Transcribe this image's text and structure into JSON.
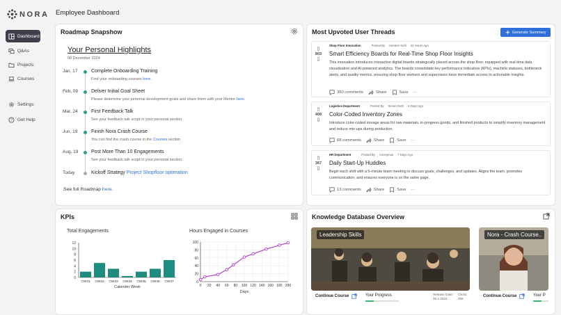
{
  "app": {
    "logo_text": "NORA",
    "page_title": "Employee Dashboard"
  },
  "sidebar": {
    "items": [
      {
        "label": "Dashboard",
        "icon": "dashboard-icon",
        "active": true
      },
      {
        "label": "Q&As",
        "icon": "chat-icon"
      },
      {
        "label": "Projects",
        "icon": "folder-icon"
      },
      {
        "label": "Courses",
        "icon": "laptop-icon"
      }
    ],
    "bottom": [
      {
        "label": "Settings",
        "icon": "gear-icon"
      },
      {
        "label": "Get Help",
        "icon": "help-icon"
      }
    ]
  },
  "roadmap": {
    "title": "Roadmap Snapshow",
    "highlights_title": "Your Personal Highlights",
    "highlights_date": "08 December 2024",
    "items": [
      {
        "date": "Jan, 17",
        "title": "Complete Onboarding Training",
        "sub": "Find your onboarding courses ",
        "link": "here",
        "sub_after": "."
      },
      {
        "date": "Feb, 09",
        "title": "Deliver Initial Goal Sheet",
        "sub": "Please determine your personal development goals and share them with your Mentor ",
        "link": "here",
        "sub_after": "."
      },
      {
        "date": "Mar, 24",
        "title": "First Feedback Talk",
        "sub": "See your feedback talk script in your personal section.",
        "link": "",
        "sub_after": ""
      },
      {
        "date": "Jun, 19",
        "title": "Finish Nora Crash Course",
        "sub": "You can find the crash course in the ",
        "link": "Courses",
        "sub_after": " section"
      },
      {
        "date": "Aug, 19",
        "title": "Post More Than 10 Engagements",
        "sub": "See your feedback talk script in your personal section.",
        "link": "",
        "sub_after": ""
      }
    ],
    "today": {
      "date": "Today",
      "title": "Kickoff Strategy ",
      "link": "Project Shopfloor optimation"
    },
    "footer_text": "See full Roadmap ",
    "footer_link": "here",
    "footer_after": "."
  },
  "threads": {
    "title": "Most Upvoted User Threads",
    "generate_label": "Generate Summary",
    "posted_by_label": "Posted By",
    "items": [
      {
        "votes": "803",
        "category": "Shop Floor Innovation",
        "author": "Karsten Suhl",
        "time": "22 Hours Ago",
        "title": "Smart Efficiency Boards for Real-Time Shop Floor Insights",
        "body": "This innovation introduces interactive digital boards strategically placed across the shop floor, equipped with real-time data visualization and AI-powered analytics. The boards consolidate key performance indicators (KPIs), machine statuses, bottleneck alerts, and quality metrics, ensuring shop floor workers and supervisors have immediate access to actionable insights.",
        "comments": "360 comments",
        "share": "Share",
        "save": "Save",
        "more": "···"
      },
      {
        "votes": "409",
        "category": "Logistics Department",
        "author": "Simon Ruth",
        "time": "3 Days Ago",
        "title": "Color-Coded Inventory Zones",
        "body": "Introduce color-coded storage areas for raw materials, in-progress goods, and finished products to simplify inventory management and reduce mix-ups during production.",
        "comments": "68 comments",
        "share": "Share",
        "save": "Save",
        "more": "···"
      },
      {
        "votes": "367",
        "category": "HR Department",
        "author": "Anonymus",
        "time": "7 Days Ago",
        "title": "Daily Start-Up Huddles",
        "body": "Begin each shift with a 5-minute team meeting to discuss goals, challenges, and updates. Aligns the team, promotes communication, and ensures everyone is on the same page.",
        "comments": "13 comments",
        "share": "Share",
        "save": "Save",
        "more": "···"
      }
    ]
  },
  "kpis": {
    "title": "KPIs"
  },
  "chart_data": [
    {
      "type": "bar",
      "title": "Total Engagements",
      "xlabel": "Calender Week",
      "ylabel": "",
      "categories": [
        "CW31",
        "CW32",
        "CW33",
        "CW34",
        "CW35",
        "CW36",
        "CW37"
      ],
      "values": [
        2,
        5,
        3,
        0.5,
        2,
        3,
        6
      ],
      "ylim": [
        0,
        12
      ],
      "yticks": [
        "0",
        "2",
        "4",
        "6",
        "8",
        "10",
        "12"
      ],
      "color": "#1f8c80"
    },
    {
      "type": "line",
      "title": "Hours Engaged in Courses",
      "xlabel": "Days",
      "ylabel": "",
      "x": [
        0,
        10,
        40,
        60,
        75,
        100,
        120,
        150,
        180,
        200
      ],
      "y": [
        5,
        12,
        18,
        30,
        42,
        62,
        70,
        82,
        92,
        98
      ],
      "xlim": [
        0,
        200
      ],
      "ylim": [
        0,
        100
      ],
      "xticks": [
        "0",
        "20",
        "40",
        "60",
        "80",
        "100",
        "120",
        "140",
        "160",
        "180",
        "200"
      ],
      "yticks": [
        "0",
        "20",
        "40",
        "60",
        "80",
        "100"
      ],
      "color": "#b53fd0"
    }
  ],
  "knowledge": {
    "title": "Knowledge Database Overview",
    "cards": [
      {
        "tag": "Leadership Skills",
        "continue": "Continue Course",
        "progress_label": "Your Progress",
        "progress": 0.25,
        "release_label": "Release Date:",
        "release": "06.1.2023",
        "clicks_label": "Clicks:",
        "clicks": "486"
      },
      {
        "tag": "Nora - Crash Course..",
        "continue": "Continue Course",
        "progress_label": "Your P",
        "progress": 0.55
      }
    ]
  }
}
